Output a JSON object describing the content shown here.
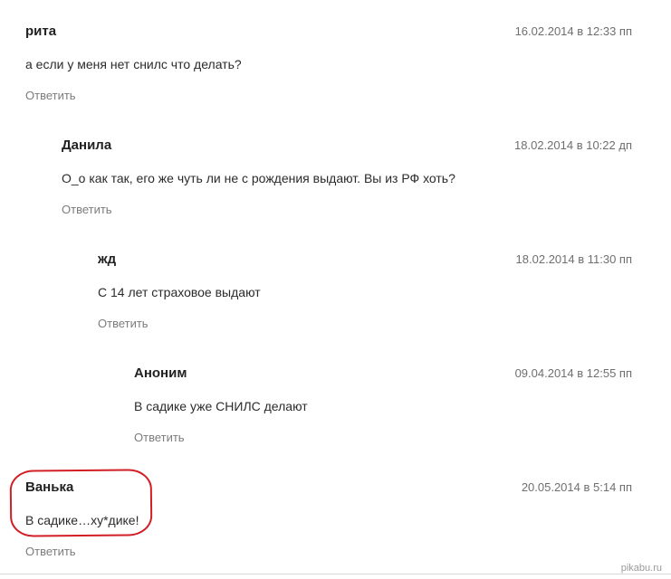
{
  "comments": [
    {
      "author": "рита",
      "date": "16.02.2014 в 12:33 пп",
      "text": "а если у меня нет снилс что делать?",
      "reply_label": "Ответить"
    },
    {
      "author": "Данила",
      "date": "18.02.2014 в 10:22 дп",
      "text": "О_о как так, его же чуть ли не с рождения выдают. Вы из РФ хоть?",
      "reply_label": "Ответить"
    },
    {
      "author": "жд",
      "date": "18.02.2014 в 11:30 пп",
      "text": "С 14 лет страховое выдают",
      "reply_label": "Ответить"
    },
    {
      "author": "Аноним",
      "date": "09.04.2014 в 12:55 пп",
      "text": "В садике уже СНИЛС делают",
      "reply_label": "Ответить"
    },
    {
      "author": "Ванька",
      "date": "20.05.2014 в 5:14 пп",
      "text": "В садике…ху*дике!",
      "reply_label": "Ответить"
    }
  ],
  "highlight_color": "#d21f26",
  "watermark": "pikabu.ru"
}
